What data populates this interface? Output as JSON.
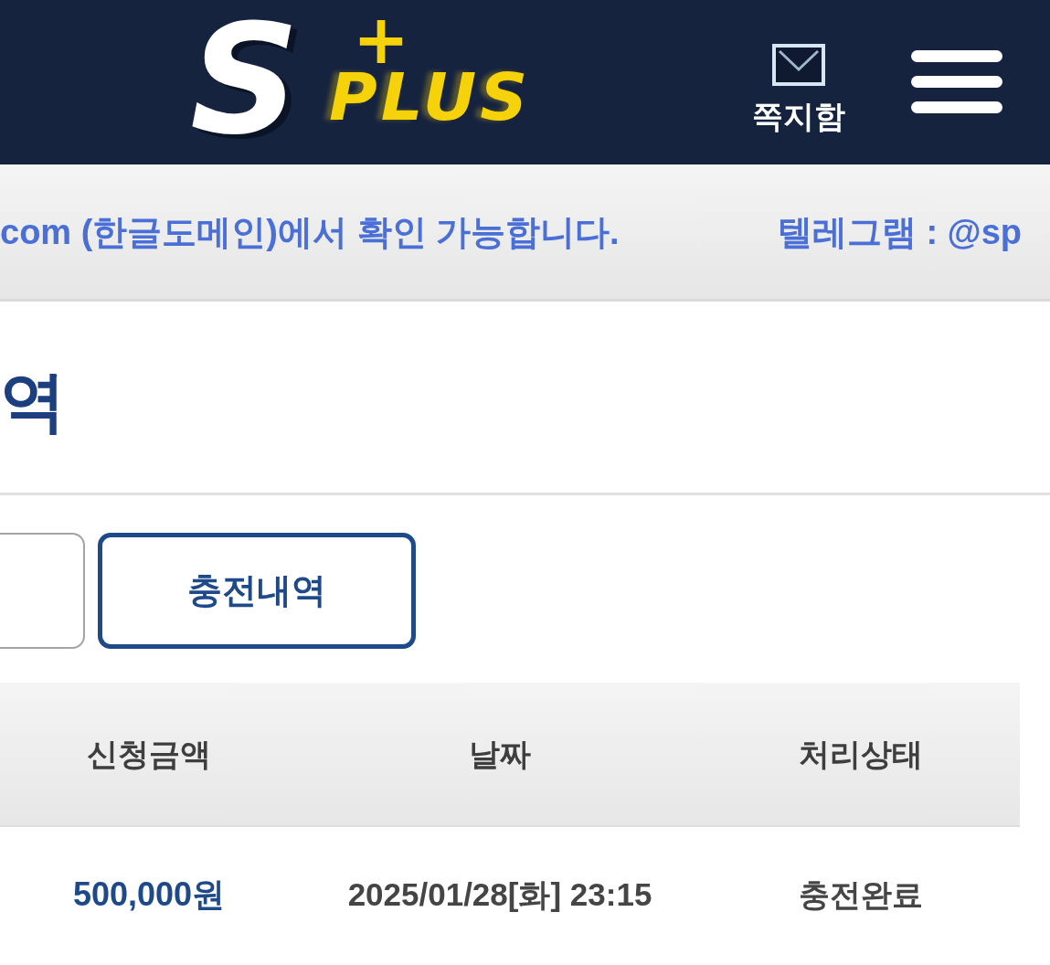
{
  "header": {
    "logo": {
      "letter": "S",
      "plus": "+",
      "word": "PLUS"
    },
    "messages": {
      "label": "쪽지함"
    }
  },
  "notice": {
    "segments": [
      "com (한글도메인)에서 확인 가능합니다.",
      "텔레그램 : @sp"
    ]
  },
  "page_title": "역",
  "tabs": [
    {
      "selected": false
    },
    {
      "label": "충전내역",
      "selected": true
    }
  ],
  "table": {
    "columns": [
      "신청금액",
      "날짜",
      "처리상태"
    ],
    "rows": [
      {
        "amount": "500,000원",
        "date": "2025/01/28[화] 23:15",
        "status": "충전완료"
      }
    ]
  }
}
